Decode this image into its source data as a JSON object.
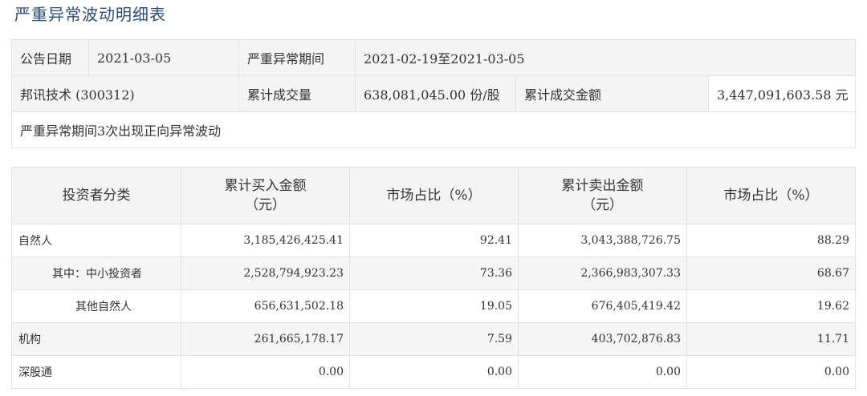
{
  "page": {
    "title": "严重异常波动明细表"
  },
  "summary": {
    "row1": {
      "announce_label": "公告日期",
      "announce_value": "2021-03-05",
      "period_label": "严重异常期间",
      "period_value": "2021-02-19至2021-03-05"
    },
    "row2": {
      "stock": "邦讯技术 (300312)",
      "volume_label": "累计成交量",
      "volume_value": "638,081,045.00 份/股",
      "amount_label": "累计成交金额",
      "amount_value": "3,447,091,603.58 元"
    },
    "row3": {
      "note": "严重异常期间3次出现正向异常波动"
    }
  },
  "detail": {
    "headers": {
      "investor_type": "投资者分类",
      "buy_amount": "累计买入金额",
      "buy_unit": "（元）",
      "buy_share": "市场占比（%）",
      "sell_amount": "累计卖出金额",
      "sell_unit": "（元）",
      "sell_share": "市场占比（%）"
    },
    "rows": [
      {
        "category": "自然人",
        "buy": "3,185,426,425.41",
        "buy_pct": "92.41",
        "sell": "3,043,388,726.75",
        "sell_pct": "88.29"
      },
      {
        "category": "其中：中小投资者",
        "buy": "2,528,794,923.23",
        "buy_pct": "73.36",
        "sell": "2,366,983,307.33",
        "sell_pct": "68.67"
      },
      {
        "category": "其他自然人",
        "buy": "656,631,502.18",
        "buy_pct": "19.05",
        "sell": "676,405,419.42",
        "sell_pct": "19.62"
      },
      {
        "category": "机构",
        "buy": "261,665,178.17",
        "buy_pct": "7.59",
        "sell": "403,702,876.83",
        "sell_pct": "11.71"
      },
      {
        "category": "深股通",
        "buy": "0.00",
        "buy_pct": "0.00",
        "sell": "0.00",
        "sell_pct": "0.00"
      }
    ]
  }
}
